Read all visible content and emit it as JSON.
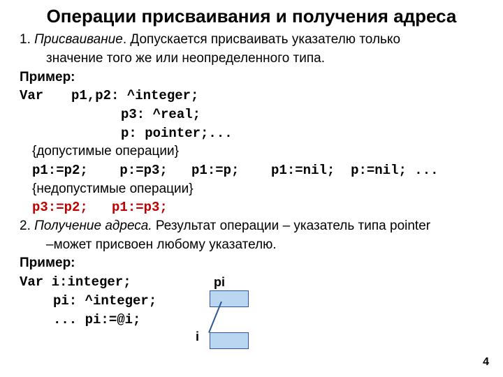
{
  "title": "Операции присваивания и получения адреса",
  "section1": {
    "lead": "1. ",
    "name_italic": "Присваивание",
    "text_after": ". Допускается присваивать указателю только",
    "text_line2": "значение того же или неопределенного типа."
  },
  "example_label": "Пример:",
  "code1": {
    "var_kw": "Var",
    "l1": "p1,p2: ^integer;",
    "l2": "p3: ^real;",
    "l3": "p: pointer;...",
    "comment_valid": "{допустимые операции}",
    "valid_line": "p1:=p2;    p:=p3;   p1:=p;    p1:=nil;  p:=nil; ...",
    "comment_invalid": "{недопустимые операции}",
    "invalid_line": "p3:=p2;   p1:=p3;"
  },
  "section2": {
    "lead": "2. ",
    "name_italic": "Получение адреса.",
    "text_after": " Результат операции – указатель типа pointer",
    "text_line2": "–может присвоен любому указателю."
  },
  "code2": {
    "l1_pre": "Var ",
    "l1": "i:integer;",
    "l2": "pi: ^integer;",
    "l3": "...  pi:=@i;"
  },
  "diagram": {
    "label_pi": "pi",
    "label_i": "i"
  },
  "page_number": "4"
}
